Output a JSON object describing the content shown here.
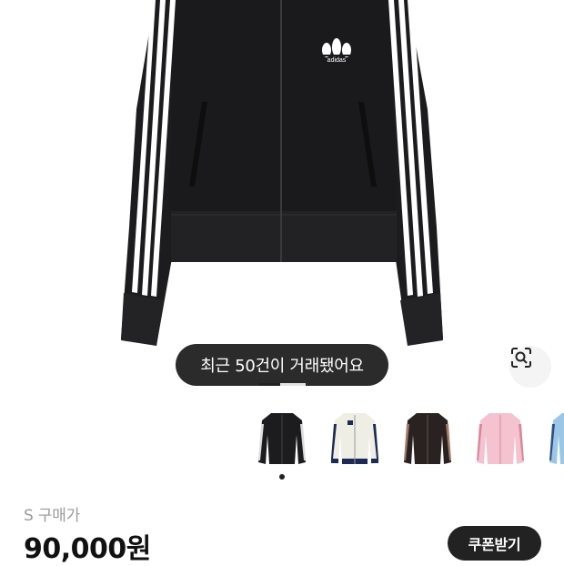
{
  "product": {
    "image_name": "black-track-jacket",
    "logo_text": "adidas",
    "trades_pill": "최근 50건이 거래됐어요",
    "lens_icon": "image-search-icon"
  },
  "thumbnails": [
    {
      "name": "black-jacket"
    },
    {
      "name": "cream-jacket"
    },
    {
      "name": "brown-jacket"
    },
    {
      "name": "pink-jacket"
    },
    {
      "name": "blue-jacket"
    }
  ],
  "purchase": {
    "size_label": "S  구매가",
    "price": "90,000원",
    "coupon_label": "쿠폰받기"
  }
}
